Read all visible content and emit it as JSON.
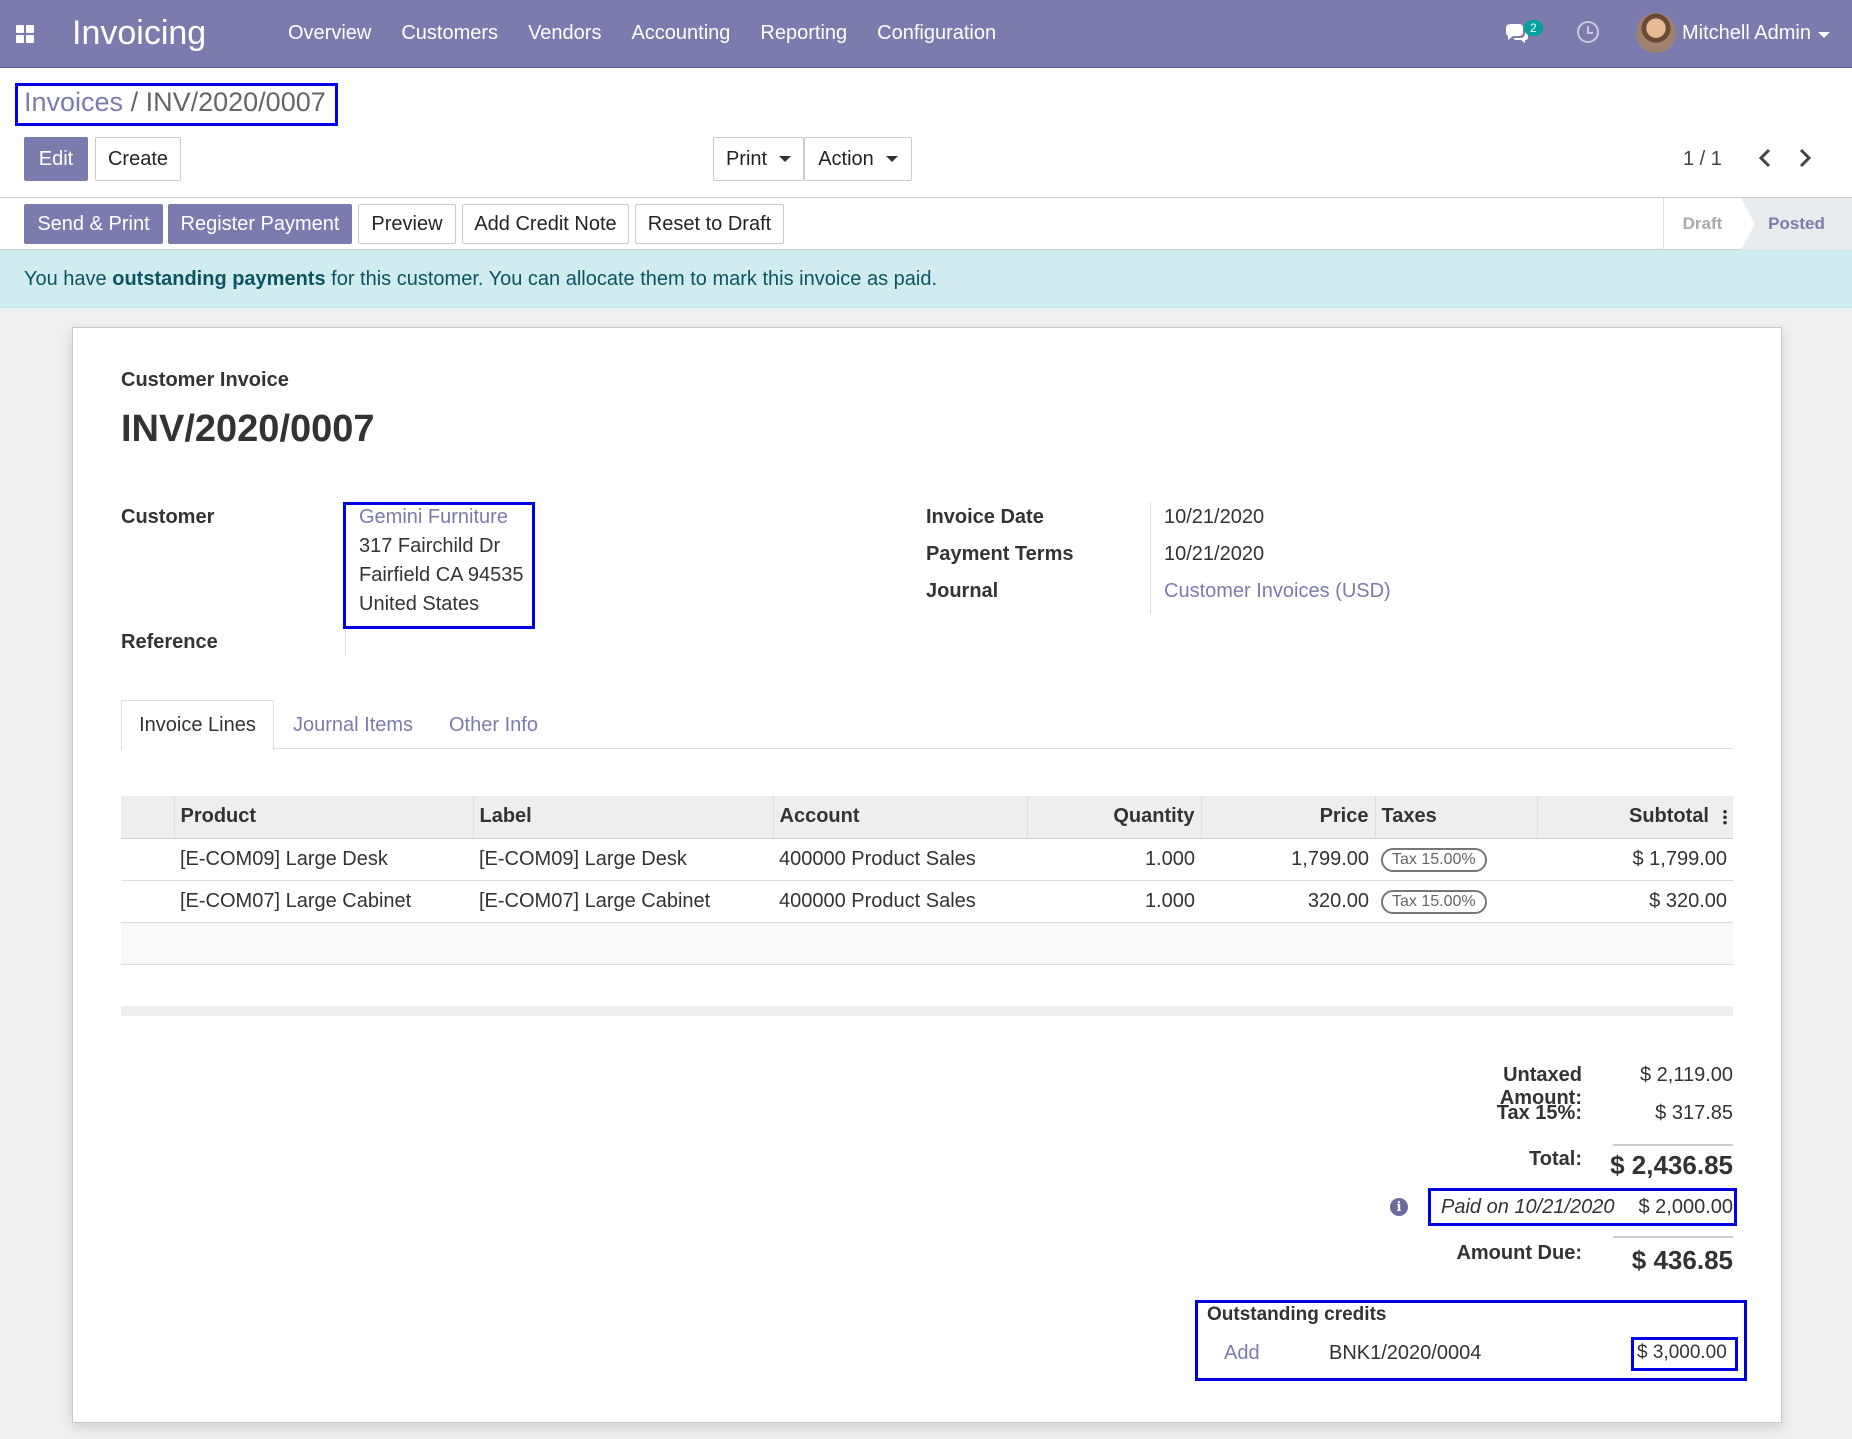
{
  "app": {
    "brand": "Invoicing",
    "menu": [
      "Overview",
      "Customers",
      "Vendors",
      "Accounting",
      "Reporting",
      "Configuration"
    ],
    "chat_count": "2",
    "user_name": "Mitchell Admin",
    "icons": {
      "apps": "apps-grid-icon",
      "chat": "chat-icon",
      "activity": "clock-icon"
    }
  },
  "breadcrumb": {
    "parent": "Invoices",
    "separator": "/",
    "current": "INV/2020/0007"
  },
  "toolbar": {
    "edit": "Edit",
    "create": "Create",
    "print": "Print",
    "action": "Action"
  },
  "pager": {
    "value": "1 / 1"
  },
  "status_buttons": {
    "send_print": "Send & Print",
    "register_payment": "Register Payment",
    "preview": "Preview",
    "add_credit_note": "Add Credit Note",
    "reset_to_draft": "Reset to Draft"
  },
  "stages": {
    "draft": "Draft",
    "posted": "Posted"
  },
  "alert": {
    "prefix": "You have ",
    "bold": "outstanding payments",
    "suffix": " for this customer. You can allocate them to mark this invoice as paid."
  },
  "invoice": {
    "type_label": "Customer Invoice",
    "number": "INV/2020/0007",
    "customer_label": "Customer",
    "customer_name": "Gemini Furniture",
    "address_line1": "317 Fairchild Dr",
    "address_line2": "Fairfield CA 94535",
    "address_line3": "United States",
    "reference_label": "Reference",
    "invoice_date_label": "Invoice Date",
    "invoice_date": "10/21/2020",
    "payment_terms_label": "Payment Terms",
    "payment_terms": "10/21/2020",
    "journal_label": "Journal",
    "journal": "Customer Invoices (USD)"
  },
  "tabs": [
    "Invoice Lines",
    "Journal Items",
    "Other Info"
  ],
  "lines": {
    "headers": {
      "product": "Product",
      "label": "Label",
      "account": "Account",
      "quantity": "Quantity",
      "price": "Price",
      "taxes": "Taxes",
      "subtotal": "Subtotal"
    },
    "rows": [
      {
        "product": "[E-COM09] Large Desk",
        "label": "[E-COM09] Large Desk",
        "account": "400000 Product Sales",
        "quantity": "1.000",
        "price": "1,799.00",
        "tax": "Tax 15.00%",
        "subtotal": "$ 1,799.00"
      },
      {
        "product": "[E-COM07] Large Cabinet",
        "label": "[E-COM07] Large Cabinet",
        "account": "400000 Product Sales",
        "quantity": "1.000",
        "price": "320.00",
        "tax": "Tax 15.00%",
        "subtotal": "$ 320.00"
      }
    ]
  },
  "totals": {
    "untaxed_label": "Untaxed Amount:",
    "untaxed": "$ 2,119.00",
    "tax_label": "Tax 15%:",
    "tax": "$ 317.85",
    "total_label": "Total:",
    "total": "$ 2,436.85",
    "paid_label": "Paid on 10/21/2020",
    "paid": "$ 2,000.00",
    "due_label": "Amount Due:",
    "due": "$ 436.85"
  },
  "outstanding": {
    "title": "Outstanding credits",
    "add": "Add",
    "ref": "BNK1/2020/0004",
    "amount": "$ 3,000.00"
  }
}
